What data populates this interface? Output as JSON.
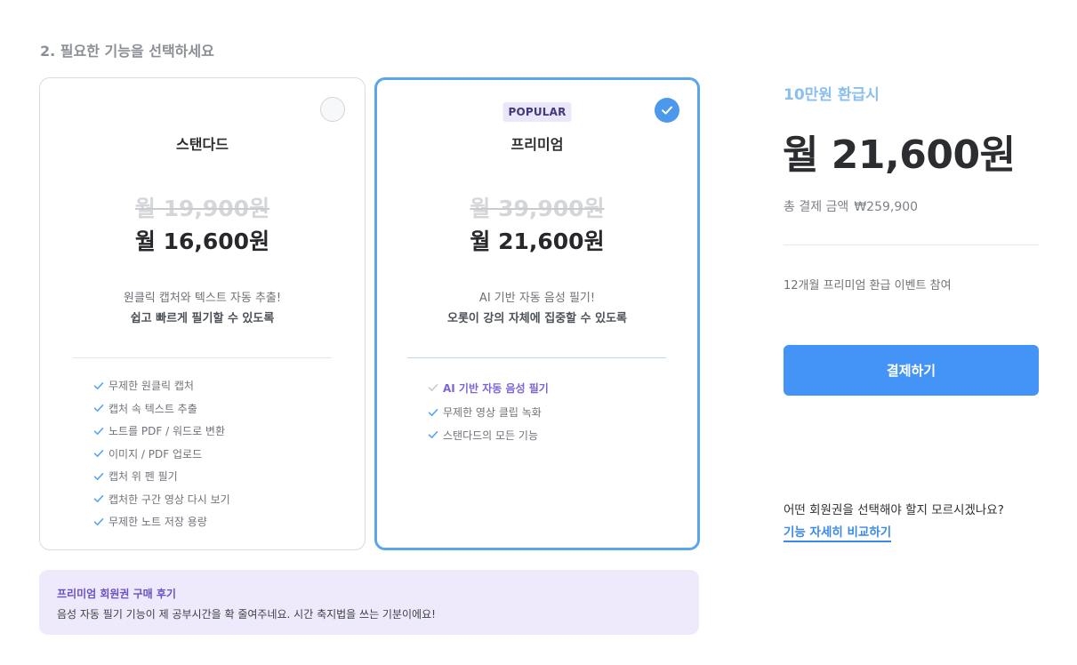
{
  "section_title": "2. 필요한 기능을 선택하세요",
  "plans": {
    "standard": {
      "name": "스탠다드",
      "original_price": "월 19,900원",
      "price": "월 16,600원",
      "desc_line1": "원클릭 캡처와 텍스트 자동 추출!",
      "desc_line2": "쉽고 빠르게 필기할 수 있도록",
      "features": [
        "무제한 원클릭 캡처",
        "캡처 속  텍스트 추출",
        "노트를 PDF / 워드로 변환",
        "이미지 / PDF 업로드",
        "캡처 위 펜 필기",
        "캡처한 구간 영상 다시 보기",
        "무제한 노트 저장 용량"
      ],
      "selected": false
    },
    "premium": {
      "badge": "POPULAR",
      "name": "프리미엄",
      "original_price": "월 39,900원",
      "price": "월 21,600원",
      "desc_line1": "AI 기반 자동 음성 필기!",
      "desc_line2": "오롯이 강의 자체에 집중할 수 있도록",
      "features": [
        "AI 기반 자동 음성 필기",
        "무제한 영상 클립 녹화",
        "스탠다드의 모든 기능"
      ],
      "selected": true
    }
  },
  "review": {
    "title": "프리미엄 회원권 구매 후기",
    "text": "음성 자동 필기 기능이 제 공부시간을 확 줄여주네요. 시간 축지법을 쓰는 기분이에요!"
  },
  "summary": {
    "refund_label": "10만원 환급시",
    "price": "월 21,600원",
    "total_label": "총 결제 금액",
    "total_value": "₩259,900",
    "event_text": "12개월 프리미엄 환급 이벤트 참여",
    "pay_button": "결제하기",
    "help_text": "어떤 회원권을 선택해야 할지 모르시겠나요?",
    "compare_link": "기능 자세히 비교하기"
  },
  "colors": {
    "accent_blue": "#4394f6",
    "selected_border": "#5aa6ec",
    "refund_text": "#8bc0ee",
    "purple": "#6a4fc7",
    "review_bg": "#efeafb"
  }
}
